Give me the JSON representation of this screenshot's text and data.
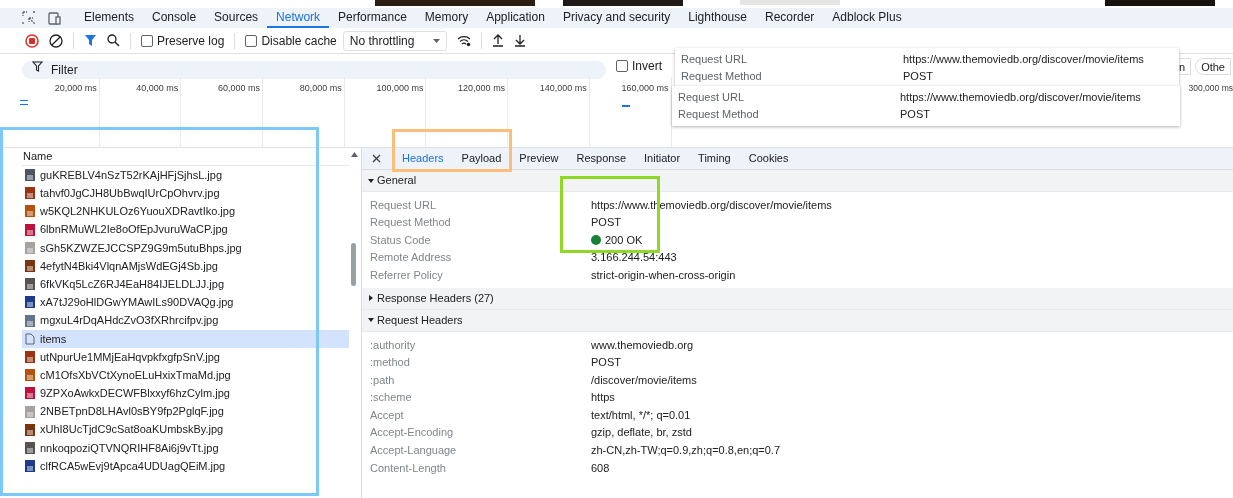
{
  "tabs": [
    {
      "label": "Elements",
      "selected": false
    },
    {
      "label": "Console",
      "selected": false
    },
    {
      "label": "Sources",
      "selected": false
    },
    {
      "label": "Network",
      "selected": true
    },
    {
      "label": "Performance",
      "selected": false
    },
    {
      "label": "Memory",
      "selected": false
    },
    {
      "label": "Application",
      "selected": false
    },
    {
      "label": "Privacy and security",
      "selected": false
    },
    {
      "label": "Lighthouse",
      "selected": false
    },
    {
      "label": "Recorder",
      "selected": false
    },
    {
      "label": "Adblock Plus",
      "selected": false
    }
  ],
  "toolbar": {
    "preserve_log": {
      "label": "Preserve log",
      "checked": false
    },
    "disable_cache": {
      "label": "Disable cache",
      "checked": false
    },
    "throttling": "No throttling"
  },
  "filter": {
    "placeholder": "Filter",
    "invert": {
      "label": "Invert",
      "checked": false
    },
    "type_buttons": [
      "n",
      "Othe"
    ]
  },
  "timeline": {
    "ticks": [
      "20,000 ms",
      "40,000 ms",
      "60,000 ms",
      "80,000 ms",
      "100,000 ms",
      "120,000 ms",
      "140,000 ms",
      "160,000 ms"
    ],
    "last_tick": "300,000 ms"
  },
  "tooltips": [
    {
      "rows": [
        {
          "name": "Request URL",
          "value": "https://www.themoviedb.org/discover/movie/items"
        },
        {
          "name": "Request Method",
          "value": "POST"
        }
      ]
    },
    {
      "rows": [
        {
          "name": "Request URL",
          "value": "https://www.themoviedb.org/discover/movie/items"
        },
        {
          "name": "Request Method",
          "value": "POST"
        }
      ]
    }
  ],
  "requests": {
    "column": "Name",
    "rows": [
      {
        "name": "guKREBLV4nSzT52rKAjHFjSjhsL.jpg",
        "selected": false
      },
      {
        "name": "tahvf0JgCJH8UbBwqIUrCpOhvrv.jpg",
        "selected": false
      },
      {
        "name": "w5KQL2NHKULOz6YuouXDRavtIko.jpg",
        "selected": false
      },
      {
        "name": "6lbnRMuWL2Ie8oOfEpJvuruWaCP.jpg",
        "selected": false
      },
      {
        "name": "sGh5KZWZEJCCSPZ9G9m5utuBhps.jpg",
        "selected": false
      },
      {
        "name": "4efytN4Bki4VlqnAMjsWdEGj4Sb.jpg",
        "selected": false
      },
      {
        "name": "6fkVKq5LcZ6RJ4EaH84IJELDLJJ.jpg",
        "selected": false
      },
      {
        "name": "xA7tJ29oHlDGwYMAwILs90DVAQg.jpg",
        "selected": false
      },
      {
        "name": "mgxuL4rDqAHdcZvO3fXRhrcifpv.jpg",
        "selected": false
      },
      {
        "name": "items",
        "kind": "document",
        "selected": true
      },
      {
        "name": "utNpurUe1MMjEaHqvpkfxgfpSnV.jpg",
        "selected": false
      },
      {
        "name": "cM1OfsXbVCtXynoELuHxixTmaMd.jpg",
        "selected": false
      },
      {
        "name": "9ZPXoAwkxDECWFBlxxyf6hzCylm.jpg",
        "selected": false
      },
      {
        "name": "2NBETpnD8LHAvl0sBY9fp2PglqF.jpg",
        "selected": false
      },
      {
        "name": "xUhI8UcTjdC9cSat8oaKUmbskBy.jpg",
        "selected": false
      },
      {
        "name": "nnkoqpoziQTVNQRIHF8Ai6j9vTt.jpg",
        "selected": false
      },
      {
        "name": "clfRCA5wEvj9tApca4UDUagQEiM.jpg",
        "selected": false
      }
    ]
  },
  "detail_tabs": [
    {
      "label": "Headers",
      "selected": true
    },
    {
      "label": "Payload",
      "selected": false
    },
    {
      "label": "Preview",
      "selected": false
    },
    {
      "label": "Response",
      "selected": false
    },
    {
      "label": "Initiator",
      "selected": false
    },
    {
      "label": "Timing",
      "selected": false
    },
    {
      "label": "Cookies",
      "selected": false
    }
  ],
  "sections": [
    {
      "title": "General",
      "expanded": true,
      "rows": [
        {
          "name": "Request URL",
          "value": "https://www.themoviedb.org/discover/movie/items"
        },
        {
          "name": "Request Method",
          "value": "POST"
        },
        {
          "name": "Status Code",
          "value": "200 OK",
          "color": "#188038"
        },
        {
          "name": "Remote Address",
          "value": "3.166.244.54:443"
        },
        {
          "name": "Referrer Policy",
          "value": "strict-origin-when-cross-origin"
        }
      ]
    },
    {
      "title": "Response Headers (27)",
      "expanded": false
    },
    {
      "title": "Request Headers",
      "expanded": true,
      "rows": [
        {
          "name": ":authority",
          "value": "www.themoviedb.org"
        },
        {
          "name": ":method",
          "value": "POST"
        },
        {
          "name": ":path",
          "value": "/discover/movie/items"
        },
        {
          "name": ":scheme",
          "value": "https"
        },
        {
          "name": "Accept",
          "value": "text/html, */*; q=0.01"
        },
        {
          "name": "Accept-Encoding",
          "value": "gzip, deflate, br, zstd"
        },
        {
          "name": "Accept-Language",
          "value": "zh-CN,zh-TW;q=0.9,zh;q=0.8,en;q=0.7"
        },
        {
          "name": "Content-Length",
          "value": "608"
        }
      ]
    }
  ]
}
